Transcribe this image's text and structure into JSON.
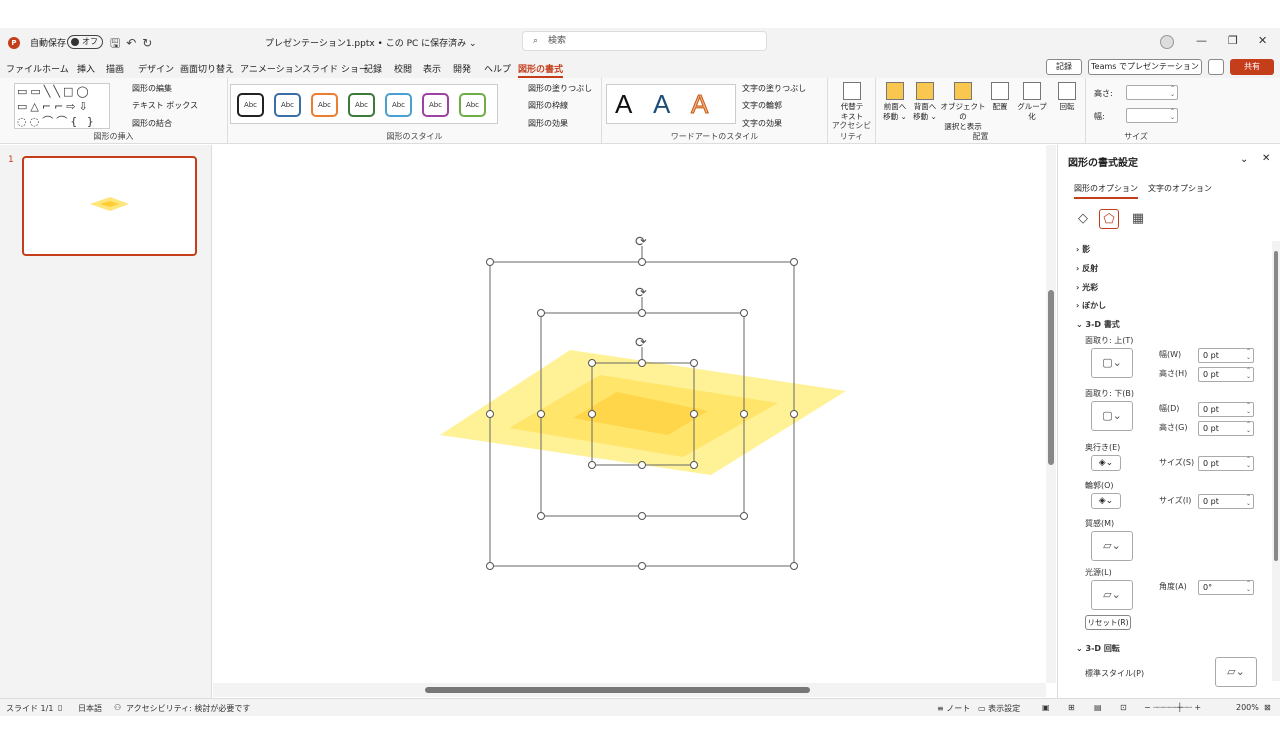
{
  "titlebar": {
    "autosave_label": "自動保存",
    "autosave_state": "オフ",
    "filename": "プレゼンテーション1.pptx • この PC に保存済み ⌄",
    "search_placeholder": "検索"
  },
  "tabs": [
    "ファイル",
    "ホーム",
    "挿入",
    "描画",
    "デザイン",
    "画面切り替え",
    "アニメーション",
    "スライド ショー",
    "記録",
    "校閲",
    "表示",
    "開発",
    "ヘルプ",
    "図形の書式"
  ],
  "active_tab": "図形の書式",
  "topbuttons": {
    "record": "記録",
    "teams": "Teams でプレゼンテーション",
    "share": "共有"
  },
  "ribbon": {
    "insert_shapes": {
      "edit_shape": "図形の編集",
      "text_box": "テキスト ボックス",
      "merge_shapes": "図形の結合",
      "label": "図形の挿入"
    },
    "shape_styles": {
      "sample": "Abc",
      "fill": "図形の塗りつぶし",
      "outline": "図形の枠線",
      "effects": "図形の効果",
      "label": "図形のスタイル",
      "colors": [
        "#222222",
        "#3a6ea5",
        "#ed7d31",
        "#3b7a3b",
        "#4aa0d0",
        "#a040a0",
        "#70ad47"
      ]
    },
    "wordart": {
      "text_fill": "文字の塗りつぶし",
      "text_outline": "文字の輪郭",
      "text_effects": "文字の効果",
      "label": "ワードアートのスタイル",
      "letter": "A"
    },
    "accessibility": {
      "alt_text_1": "代替テ",
      "alt_text_2": "キスト",
      "label": "アクセシビリティ"
    },
    "arrange": {
      "forward_1": "前面へ",
      "forward_2": "移動 ⌄",
      "backward_1": "背面へ",
      "backward_2": "移動 ⌄",
      "select_1": "オブジェクトの",
      "select_2": "選択と表示",
      "align": "配置",
      "group": "グループ化",
      "rotate": "回転",
      "label": "配置"
    },
    "size": {
      "height_label": "高さ:",
      "width_label": "幅:",
      "label": "サイズ"
    }
  },
  "thumbnail": {
    "number": "1"
  },
  "pane": {
    "title": "図形の書式設定",
    "tab_shape": "図形のオプション",
    "tab_text": "文字のオプション",
    "sections": {
      "shadow": "影",
      "reflection": "反射",
      "glow": "光彩",
      "soft_edges": "ぼかし",
      "format3d": "3-D 書式",
      "rotation3d": "3-D 回転"
    },
    "bevel_top": "面取り: 上(T)",
    "bevel_bottom": "面取り: 下(B)",
    "width": "幅(W)",
    "height": "高さ(H)",
    "width_d": "幅(D)",
    "height_g": "高さ(G)",
    "depth": "奥行き(E)",
    "contour": "輪郭(O)",
    "size_s": "サイズ(S)",
    "size_i": "サイズ(I)",
    "material": "質感(M)",
    "lighting": "光源(L)",
    "angle": "角度(A)",
    "reset": "リセット(R)",
    "preset": "標準スタイル(P)",
    "values": {
      "top_w": "0 pt",
      "top_h": "0 pt",
      "bot_w": "0 pt",
      "bot_h": "0 pt",
      "depth": "0 pt",
      "contour": "0 pt",
      "angle": "0°"
    }
  },
  "status": {
    "slide": "スライド 1/1",
    "lang": "日本語",
    "accessibility": "アクセシビリティ: 検討が必要です",
    "notes": "ノート",
    "display": "表示設定",
    "zoom": "200%"
  }
}
